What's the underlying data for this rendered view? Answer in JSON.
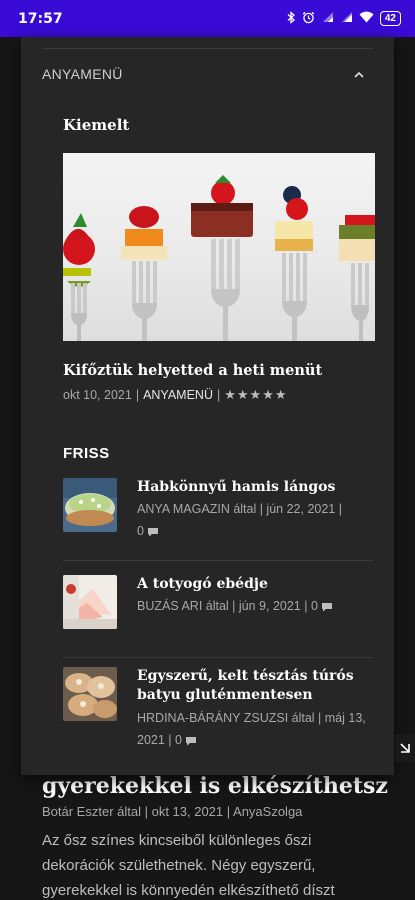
{
  "status_bar": {
    "time": "17:57",
    "battery": "42",
    "icons": [
      "bluetooth-icon",
      "alarm-icon",
      "signal-icon",
      "signal-icon",
      "wifi-icon",
      "battery-icon"
    ]
  },
  "menu": {
    "label": "ANYAMENÜ",
    "expanded": true
  },
  "featured": {
    "section_title": "Kiemelt",
    "title": "Kifőztük helyetted a heti menüt",
    "date": "okt 10, 2021",
    "separator": "|",
    "category": "ANYAMENÜ",
    "rating_stars": "★★★★★",
    "rating": 5
  },
  "fresh": {
    "section_title": "FRISS",
    "items": [
      {
        "title": "Habkönnyű hamis lángos",
        "meta": "ANYA MAGAZIN által | jún 22, 2021 |",
        "comments": "0"
      },
      {
        "title": "A totyogó ebédje",
        "meta": "BUZÁS ARI által | jún 9, 2021 | 0",
        "comments": ""
      },
      {
        "title": "Egyszerű, kelt tésztás túrós batyu gluténmentesen",
        "meta": "HRDINA-BÁRÁNY ZSUZSI által | máj 13, 2021 | 0",
        "comments": ""
      }
    ]
  },
  "background_article": {
    "title": "gyerekekkel is elkészíthetsz",
    "meta": "Botár Eszter által | okt 13, 2021 | AnyaSzolga",
    "excerpt": "Az ősz színes kincseiből különleges őszi dekorációk születhetnek. Négy egyszerű, gyerekekkel is könnyedén elkészíthető díszt"
  },
  "colors": {
    "status_bar": "#3a0ad6",
    "panel": "#262626",
    "page": "#161616",
    "text": "#ffffff",
    "meta": "#a8a8a8"
  }
}
